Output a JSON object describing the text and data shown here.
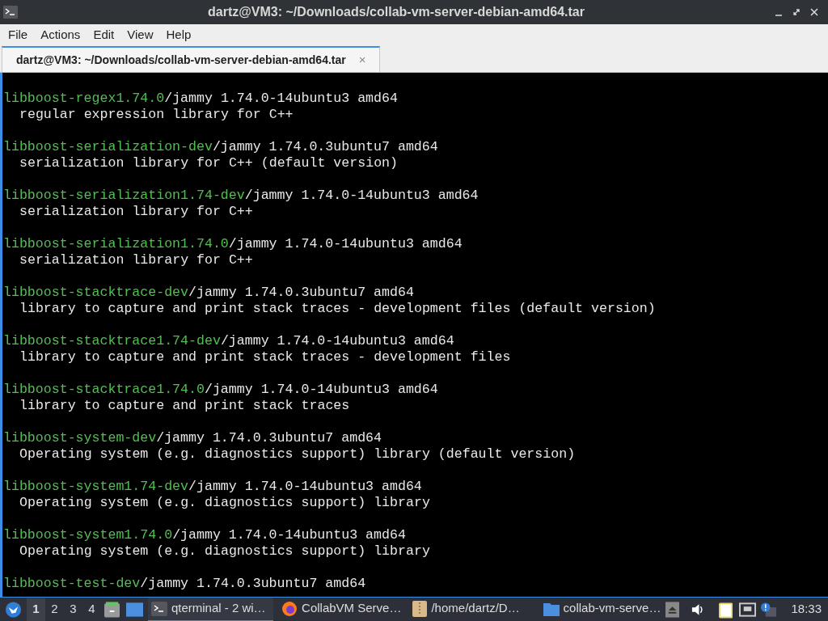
{
  "window": {
    "title": "dartz@VM3: ~/Downloads/collab-vm-server-debian-amd64.tar"
  },
  "menu": [
    "File",
    "Actions",
    "Edit",
    "View",
    "Help"
  ],
  "tabs": [
    {
      "label": "dartz@VM3: ~/Downloads/collab-vm-server-debian-amd64.tar",
      "close": "×",
      "selected": true
    }
  ],
  "terminal": {
    "packages": [
      {
        "name": "libboost-regex1.74.0",
        "info": "/jammy 1.74.0-14ubuntu3 amd64",
        "description": "regular expression library for C++"
      },
      {
        "name": "libboost-serialization-dev",
        "info": "/jammy 1.74.0.3ubuntu7 amd64",
        "description": "serialization library for C++ (default version)"
      },
      {
        "name": "libboost-serialization1.74-dev",
        "info": "/jammy 1.74.0-14ubuntu3 amd64",
        "description": "serialization library for C++"
      },
      {
        "name": "libboost-serialization1.74.0",
        "info": "/jammy 1.74.0-14ubuntu3 amd64",
        "description": "serialization library for C++"
      },
      {
        "name": "libboost-stacktrace-dev",
        "info": "/jammy 1.74.0.3ubuntu7 amd64",
        "description": "library to capture and print stack traces - development files (default version)"
      },
      {
        "name": "libboost-stacktrace1.74-dev",
        "info": "/jammy 1.74.0-14ubuntu3 amd64",
        "description": "library to capture and print stack traces - development files"
      },
      {
        "name": "libboost-stacktrace1.74.0",
        "info": "/jammy 1.74.0-14ubuntu3 amd64",
        "description": "library to capture and print stack traces"
      },
      {
        "name": "libboost-system-dev",
        "info": "/jammy 1.74.0.3ubuntu7 amd64",
        "description": "Operating system (e.g. diagnostics support) library (default version)"
      },
      {
        "name": "libboost-system1.74-dev",
        "info": "/jammy 1.74.0-14ubuntu3 amd64",
        "description": "Operating system (e.g. diagnostics support) library"
      },
      {
        "name": "libboost-system1.74.0",
        "info": "/jammy 1.74.0-14ubuntu3 amd64",
        "description": "Operating system (e.g. diagnostics support) library"
      },
      {
        "name": "libboost-test-dev",
        "info": "/jammy 1.74.0.3ubuntu7 amd64"
      }
    ]
  },
  "taskbar": {
    "workspaces": [
      {
        "label": "1",
        "selected": true
      },
      {
        "label": "2",
        "selected": false
      },
      {
        "label": "3",
        "selected": false
      },
      {
        "label": "4",
        "selected": false
      }
    ],
    "tasks": [
      {
        "kind": "terminal",
        "label": "qterminal - 2 wi…",
        "selected": true
      },
      {
        "kind": "browser",
        "label": "CollabVM Serve…",
        "selected": false
      },
      {
        "kind": "archive",
        "label": "/home/dartz/D…",
        "selected": false
      },
      {
        "kind": "folder",
        "label": "collab-vm-serve…",
        "selected": false
      }
    ],
    "clock": "18:33"
  }
}
